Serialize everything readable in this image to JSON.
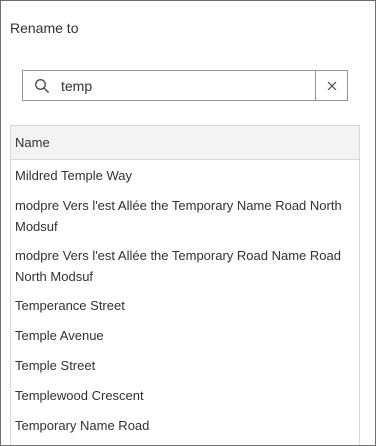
{
  "dialog": {
    "title": "Rename to"
  },
  "search": {
    "value": "temp",
    "placeholder": ""
  },
  "table": {
    "header": "Name",
    "rows": [
      "Mildred Temple Way",
      "modpre Vers l'est Allée the Temporary Name Road North Modsuf",
      "modpre Vers l'est Allée the Temporary Road Name Road North Modsuf",
      "Temperance Street",
      "Temple Avenue",
      "Temple Street",
      "Templewood Crescent",
      "Temporary Name Road"
    ]
  },
  "icons": {
    "search": "search-icon",
    "clear": "close-icon"
  },
  "colors": {
    "border": "#959595",
    "header_bg": "#f3f3f3",
    "text": "#323232"
  }
}
